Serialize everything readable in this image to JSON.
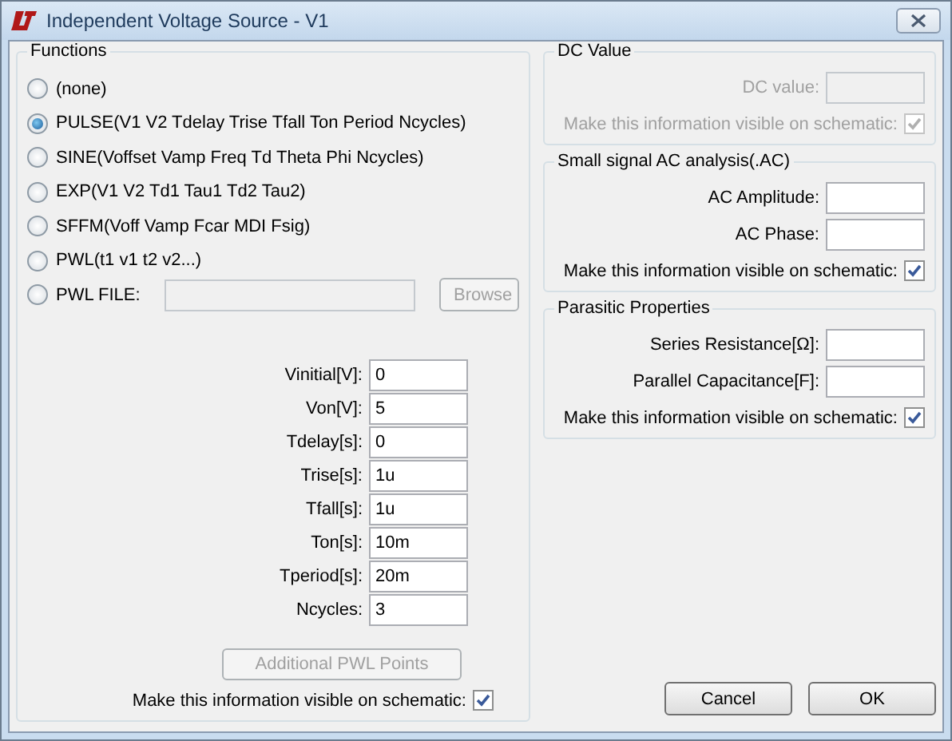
{
  "window": {
    "title": "Independent Voltage Source - V1"
  },
  "functions": {
    "title": "Functions",
    "options": [
      {
        "kind": "radio",
        "label": "(none)",
        "selected": false
      },
      {
        "kind": "radio",
        "label": "PULSE(V1 V2 Tdelay Trise Tfall Ton Period Ncycles)",
        "selected": true
      },
      {
        "kind": "radio",
        "label": "SINE(Voffset Vamp Freq Td Theta Phi Ncycles)",
        "selected": false
      },
      {
        "kind": "radio",
        "label": "EXP(V1 V2 Td1 Tau1 Td2 Tau2)",
        "selected": false
      },
      {
        "kind": "radio",
        "label": "SFFM(Voff Vamp Fcar MDI Fsig)",
        "selected": false
      },
      {
        "kind": "radio",
        "label": "PWL(t1 v1 t2 v2...)",
        "selected": false
      },
      {
        "kind": "file",
        "label": "PWL FILE:",
        "selected": false,
        "button": {
          "label": "Browse",
          "disabled": true
        }
      }
    ],
    "parameters": [
      {
        "label": "Vinitial[V]:",
        "value": "0"
      },
      {
        "label": "Von[V]:",
        "value": "5"
      },
      {
        "label": "Tdelay[s]:",
        "value": "0"
      },
      {
        "label": "Trise[s]:",
        "value": "1u"
      },
      {
        "label": "Tfall[s]:",
        "value": "1u"
      },
      {
        "label": "Ton[s]:",
        "value": "10m"
      },
      {
        "label": "Tperiod[s]:",
        "value": "20m"
      },
      {
        "label": "Ncycles:",
        "value": "3"
      }
    ],
    "additional_button": {
      "label": "Additional PWL Points",
      "disabled": true
    },
    "visible_checkbox": {
      "label": "Make this information visible on schematic:",
      "checked": true
    }
  },
  "groups": [
    {
      "title": "DC Value",
      "disabled": true,
      "fields": [
        {
          "label": "DC value:"
        }
      ],
      "visible_checkbox": {
        "label": "Make this information visible on schematic:",
        "checked": true
      }
    },
    {
      "title": "Small signal AC analysis(.AC)",
      "disabled": false,
      "fields": [
        {
          "label": "AC Amplitude:"
        },
        {
          "label": "AC Phase:"
        }
      ],
      "visible_checkbox": {
        "label": "Make this information visible on schematic:",
        "checked": true
      }
    },
    {
      "title": "Parasitic Properties",
      "disabled": false,
      "fields": [
        {
          "label": "Series Resistance[Ω]:"
        },
        {
          "label": "Parallel Capacitance[F]:"
        }
      ],
      "visible_checkbox": {
        "label": "Make this information visible on schematic:",
        "checked": true
      }
    }
  ],
  "buttons": [
    {
      "label": "Cancel"
    },
    {
      "label": "OK"
    }
  ]
}
